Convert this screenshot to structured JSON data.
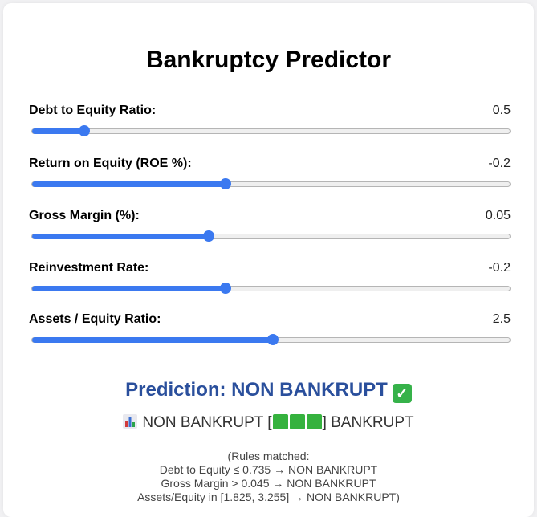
{
  "title": "Bankruptcy Predictor",
  "sliders": [
    {
      "label": "Debt to Equity Ratio:",
      "value": "0.5",
      "fill_fraction": 0.11
    },
    {
      "label": "Return on Equity (ROE %):",
      "value": "-0.2",
      "fill_fraction": 0.405
    },
    {
      "label": "Gross Margin (%):",
      "value": "0.05",
      "fill_fraction": 0.37
    },
    {
      "label": "Reinvestment Rate:",
      "value": "-0.2",
      "fill_fraction": 0.405
    },
    {
      "label": "Assets / Equity Ratio:",
      "value": "2.5",
      "fill_fraction": 0.505
    }
  ],
  "prediction": {
    "text": "Prediction: NON BANKRUPT",
    "icon": "check-mark-icon",
    "color": "#2a4f9c"
  },
  "scale": {
    "icon": "bar-chart-icon",
    "left_label": "NON BANKRUPT [",
    "right_label": "] BANKRUPT",
    "filled_blocks": 3,
    "block_color": "#35b23e"
  },
  "rules": {
    "header": "(Rules matched:",
    "lines": [
      "Debt to Equity ≤ 0.735 → NON BANKRUPT",
      "Gross Margin > 0.045 → NON BANKRUPT",
      "Assets/Equity in [1.825, 3.255] → NON BANKRUPT)"
    ]
  },
  "accent_color": "#3b79f0"
}
